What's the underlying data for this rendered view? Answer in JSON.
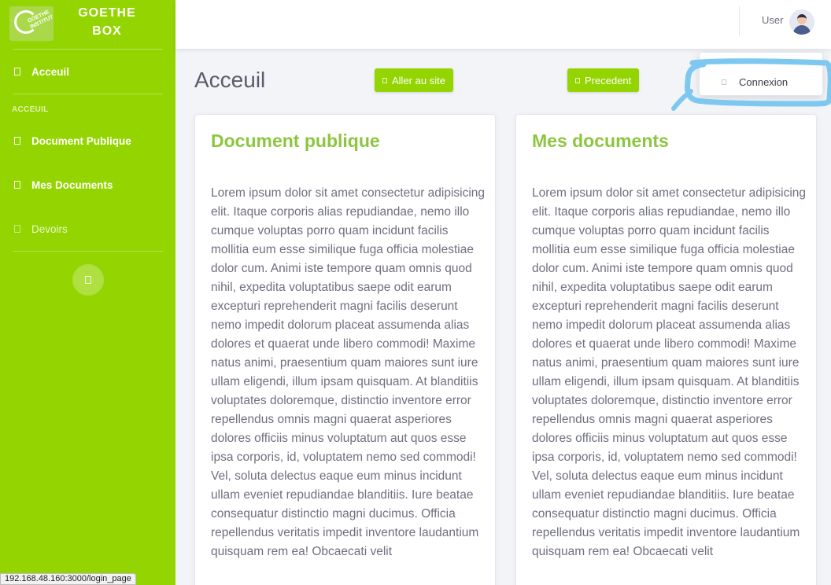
{
  "brand": {
    "title": "GOETHE BOX",
    "logo_text": "GOETHE INSTITUT"
  },
  "sidebar": {
    "top_item": {
      "label": "Acceuil",
      "icon": "home-icon"
    },
    "section_heading": "ACCEUIL",
    "items": [
      {
        "label": "Document Publique",
        "icon": "folder-icon"
      },
      {
        "label": "Mes Documents",
        "icon": "file-icon"
      },
      {
        "label": "Devoirs",
        "icon": "tasks-icon"
      }
    ],
    "toggle_icon": "chevron-left-icon"
  },
  "topbar": {
    "user_name": "User",
    "avatar_icon": "user-avatar-icon"
  },
  "dropdown": {
    "items": [
      {
        "label": "Connexion",
        "icon": "sign-in-icon"
      }
    ]
  },
  "main": {
    "title": "Acceuil",
    "buttons": {
      "site": "Aller au site",
      "previous": "Precedent"
    },
    "cards": [
      {
        "title": "Document publique",
        "body": "Lorem ipsum dolor sit amet consectetur adipisicing elit. Itaque corporis alias repudiandae, nemo illo cumque voluptas porro quam incidunt facilis mollitia eum esse similique fuga officia molestiae dolor cum. Animi iste tempore quam omnis quod nihil, expedita voluptatibus saepe odit earum excepturi reprehenderit magni facilis deserunt nemo impedit dolorum placeat assumenda alias dolores et quaerat unde libero commodi! Maxime natus animi, praesentium quam maiores sunt iure ullam eligendi, illum ipsam quisquam. At blanditiis voluptates doloremque, distinctio inventore error repellendus omnis magni quaerat asperiores dolores officiis minus voluptatum aut quos esse ipsa corporis, id, voluptatem nemo sed commodi! Vel, soluta delectus eaque eum minus incidunt ullam eveniet repudiandae blanditiis. Iure beatae consequatur distinctio magni ducimus. Officia repellendus veritatis impedit inventore laudantium quisquam rem ea! Obcaecati velit"
      },
      {
        "title": "Mes documents",
        "body": "Lorem ipsum dolor sit amet consectetur adipisicing elit. Itaque corporis alias repudiandae, nemo illo cumque voluptas porro quam incidunt facilis mollitia eum esse similique fuga officia molestiae dolor cum. Animi iste tempore quam omnis quod nihil, expedita voluptatibus saepe odit earum excepturi reprehenderit magni facilis deserunt nemo impedit dolorum placeat assumenda alias dolores et quaerat unde libero commodi! Maxime natus animi, praesentium quam maiores sunt iure ullam eligendi, illum ipsam quisquam. At blanditiis voluptates doloremque, distinctio inventore error repellendus omnis magni quaerat asperiores dolores officiis minus voluptatum aut quos esse ipsa corporis, id, voluptatem nemo sed commodi! Vel, soluta delectus eaque eum minus incidunt ullam eveniet repudiandae blanditiis. Iure beatae consequatur distinctio magni ducimus. Officia repellendus veritatis impedit inventore laudantium quisquam rem ea! Obcaecati velit"
      }
    ]
  },
  "statusbar": {
    "url": "192.168.48.160:3000/login_page"
  },
  "colors": {
    "accent": "#94d400",
    "heading_green": "#8cc63f",
    "annotation": "#7cc8f0"
  }
}
